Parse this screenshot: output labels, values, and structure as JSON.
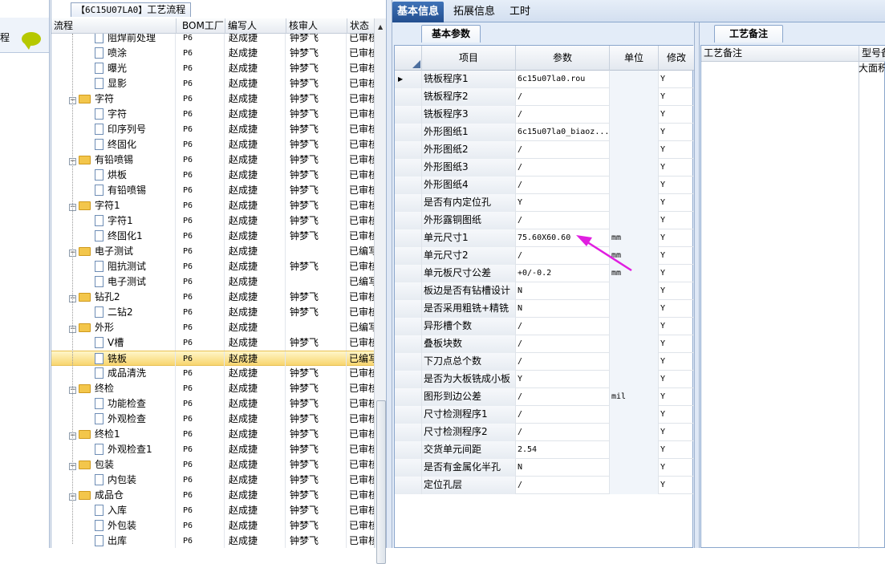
{
  "left_panel": {
    "label": "程"
  },
  "tree": {
    "tab_code": "【6C15U07LA0】",
    "tab_title": "工艺流程",
    "headers": [
      "流程",
      "BOM工厂",
      "编写人",
      "核审人",
      "状态"
    ],
    "rows": [
      {
        "level": 2,
        "type": "doc",
        "name": "阻焊前处理",
        "bom": "P6",
        "writer": "赵成捷",
        "reviewer": "钟梦飞",
        "status": "已审核"
      },
      {
        "level": 2,
        "type": "doc",
        "name": "喷涂",
        "bom": "P6",
        "writer": "赵成捷",
        "reviewer": "钟梦飞",
        "status": "已审核"
      },
      {
        "level": 2,
        "type": "doc",
        "name": "曝光",
        "bom": "P6",
        "writer": "赵成捷",
        "reviewer": "钟梦飞",
        "status": "已审核"
      },
      {
        "level": 2,
        "type": "doc",
        "name": "显影",
        "bom": "P6",
        "writer": "赵成捷",
        "reviewer": "钟梦飞",
        "status": "已审核"
      },
      {
        "level": 1,
        "type": "folder",
        "name": "字符",
        "bom": "P6",
        "writer": "赵成捷",
        "reviewer": "钟梦飞",
        "status": "已审核"
      },
      {
        "level": 2,
        "type": "doc",
        "name": "字符",
        "bom": "P6",
        "writer": "赵成捷",
        "reviewer": "钟梦飞",
        "status": "已审核"
      },
      {
        "level": 2,
        "type": "doc",
        "name": "印序列号",
        "bom": "P6",
        "writer": "赵成捷",
        "reviewer": "钟梦飞",
        "status": "已审核"
      },
      {
        "level": 2,
        "type": "doc",
        "name": "终固化",
        "bom": "P6",
        "writer": "赵成捷",
        "reviewer": "钟梦飞",
        "status": "已审核"
      },
      {
        "level": 1,
        "type": "folder",
        "name": "有铅喷锡",
        "bom": "P6",
        "writer": "赵成捷",
        "reviewer": "钟梦飞",
        "status": "已审核"
      },
      {
        "level": 2,
        "type": "doc",
        "name": "烘板",
        "bom": "P6",
        "writer": "赵成捷",
        "reviewer": "钟梦飞",
        "status": "已审核"
      },
      {
        "level": 2,
        "type": "doc",
        "name": "有铅喷锡",
        "bom": "P6",
        "writer": "赵成捷",
        "reviewer": "钟梦飞",
        "status": "已审核"
      },
      {
        "level": 1,
        "type": "folder",
        "name": "字符1",
        "bom": "P6",
        "writer": "赵成捷",
        "reviewer": "钟梦飞",
        "status": "已审核"
      },
      {
        "level": 2,
        "type": "doc",
        "name": "字符1",
        "bom": "P6",
        "writer": "赵成捷",
        "reviewer": "钟梦飞",
        "status": "已审核"
      },
      {
        "level": 2,
        "type": "doc",
        "name": "终固化1",
        "bom": "P6",
        "writer": "赵成捷",
        "reviewer": "钟梦飞",
        "status": "已审核"
      },
      {
        "level": 1,
        "type": "folder",
        "name": "电子测试",
        "bom": "P6",
        "writer": "赵成捷",
        "reviewer": "",
        "status": "已编写"
      },
      {
        "level": 2,
        "type": "doc",
        "name": "阻抗测试",
        "bom": "P6",
        "writer": "赵成捷",
        "reviewer": "钟梦飞",
        "status": "已审核"
      },
      {
        "level": 2,
        "type": "doc",
        "name": "电子测试",
        "bom": "P6",
        "writer": "赵成捷",
        "reviewer": "",
        "status": "已编写"
      },
      {
        "level": 1,
        "type": "folder",
        "name": "钻孔2",
        "bom": "P6",
        "writer": "赵成捷",
        "reviewer": "钟梦飞",
        "status": "已审核"
      },
      {
        "level": 2,
        "type": "doc",
        "name": "二钻2",
        "bom": "P6",
        "writer": "赵成捷",
        "reviewer": "钟梦飞",
        "status": "已审核"
      },
      {
        "level": 1,
        "type": "folder",
        "name": "外形",
        "bom": "P6",
        "writer": "赵成捷",
        "reviewer": "",
        "status": "已编写"
      },
      {
        "level": 2,
        "type": "doc",
        "name": "V槽",
        "bom": "P6",
        "writer": "赵成捷",
        "reviewer": "钟梦飞",
        "status": "已审核"
      },
      {
        "level": 2,
        "type": "doc",
        "name": "铣板",
        "bom": "P6",
        "writer": "赵成捷",
        "reviewer": "",
        "status": "已编写",
        "selected": true
      },
      {
        "level": 2,
        "type": "doc",
        "name": "成品清洗",
        "bom": "P6",
        "writer": "赵成捷",
        "reviewer": "钟梦飞",
        "status": "已审核"
      },
      {
        "level": 1,
        "type": "folder",
        "name": "终检",
        "bom": "P6",
        "writer": "赵成捷",
        "reviewer": "钟梦飞",
        "status": "已审核"
      },
      {
        "level": 2,
        "type": "doc",
        "name": "功能检查",
        "bom": "P6",
        "writer": "赵成捷",
        "reviewer": "钟梦飞",
        "status": "已审核"
      },
      {
        "level": 2,
        "type": "doc",
        "name": "外观检查",
        "bom": "P6",
        "writer": "赵成捷",
        "reviewer": "钟梦飞",
        "status": "已审核"
      },
      {
        "level": 1,
        "type": "folder",
        "name": "终检1",
        "bom": "P6",
        "writer": "赵成捷",
        "reviewer": "钟梦飞",
        "status": "已审核"
      },
      {
        "level": 2,
        "type": "doc",
        "name": "外观检查1",
        "bom": "P6",
        "writer": "赵成捷",
        "reviewer": "钟梦飞",
        "status": "已审核"
      },
      {
        "level": 1,
        "type": "folder",
        "name": "包装",
        "bom": "P6",
        "writer": "赵成捷",
        "reviewer": "钟梦飞",
        "status": "已审核"
      },
      {
        "level": 2,
        "type": "doc",
        "name": "内包装",
        "bom": "P6",
        "writer": "赵成捷",
        "reviewer": "钟梦飞",
        "status": "已审核"
      },
      {
        "level": 1,
        "type": "folder",
        "name": "成品仓",
        "bom": "P6",
        "writer": "赵成捷",
        "reviewer": "钟梦飞",
        "status": "已审核"
      },
      {
        "level": 2,
        "type": "doc",
        "name": "入库",
        "bom": "P6",
        "writer": "赵成捷",
        "reviewer": "钟梦飞",
        "status": "已审核"
      },
      {
        "level": 2,
        "type": "doc",
        "name": "外包装",
        "bom": "P6",
        "writer": "赵成捷",
        "reviewer": "钟梦飞",
        "status": "已审核"
      },
      {
        "level": 2,
        "type": "doc",
        "name": "出库",
        "bom": "P6",
        "writer": "赵成捷",
        "reviewer": "钟梦飞",
        "status": "已审核"
      }
    ]
  },
  "tabs": [
    "基本信息",
    "拓展信息",
    "工时"
  ],
  "params": {
    "subtab": "基本参数",
    "headers": [
      "项目",
      "参数",
      "单位",
      "修改"
    ],
    "rows": [
      {
        "item": "铣板程序1",
        "param": "6c15u07la0.rou",
        "unit": "",
        "mod": "Y",
        "current": true
      },
      {
        "item": "铣板程序2",
        "param": "/",
        "unit": "",
        "mod": "Y"
      },
      {
        "item": "铣板程序3",
        "param": "/",
        "unit": "",
        "mod": "Y"
      },
      {
        "item": "外形图纸1",
        "param": "6c15u07la0_biaoz...",
        "unit": "",
        "mod": "Y"
      },
      {
        "item": "外形图纸2",
        "param": "/",
        "unit": "",
        "mod": "Y"
      },
      {
        "item": "外形图纸3",
        "param": "/",
        "unit": "",
        "mod": "Y"
      },
      {
        "item": "外形图纸4",
        "param": "/",
        "unit": "",
        "mod": "Y"
      },
      {
        "item": "是否有内定位孔",
        "param": "Y",
        "unit": "",
        "mod": "Y"
      },
      {
        "item": "外形露铜图纸",
        "param": "/",
        "unit": "",
        "mod": "Y"
      },
      {
        "item": "单元尺寸1",
        "param": "75.60X60.60",
        "unit": "mm",
        "mod": "Y"
      },
      {
        "item": "单元尺寸2",
        "param": "/",
        "unit": "mm",
        "mod": "Y"
      },
      {
        "item": "单元板尺寸公差",
        "param": "+0/-0.2",
        "unit": "mm",
        "mod": "Y"
      },
      {
        "item": "板边是否有钻槽设计",
        "param": "N",
        "unit": "",
        "mod": "Y"
      },
      {
        "item": "是否采用粗铣+精铣",
        "param": "N",
        "unit": "",
        "mod": "Y"
      },
      {
        "item": "异形槽个数",
        "param": "/",
        "unit": "",
        "mod": "Y"
      },
      {
        "item": "叠板块数",
        "param": "/",
        "unit": "",
        "mod": "Y"
      },
      {
        "item": "下刀点总个数",
        "param": "/",
        "unit": "",
        "mod": "Y"
      },
      {
        "item": "是否为大板铣成小板",
        "param": "Y",
        "unit": "",
        "mod": "Y"
      },
      {
        "item": "图形到边公差",
        "param": "/",
        "unit": "mil",
        "mod": "Y"
      },
      {
        "item": "尺寸检测程序1",
        "param": "/",
        "unit": "",
        "mod": "Y"
      },
      {
        "item": "尺寸检测程序2",
        "param": "/",
        "unit": "",
        "mod": "Y"
      },
      {
        "item": "交货单元间距",
        "param": "2.54",
        "unit": "",
        "mod": "Y"
      },
      {
        "item": "是否有金属化半孔",
        "param": "N",
        "unit": "",
        "mod": "Y"
      },
      {
        "item": "定位孔层",
        "param": "/",
        "unit": "",
        "mod": "Y"
      }
    ]
  },
  "notes": {
    "tab": "工艺备注",
    "headers": [
      "工艺备注",
      "型号备"
    ],
    "cell": "大面积"
  },
  "colors": {
    "arrow": "#e01ee0",
    "active_tab": "#2b5aa0",
    "selected_row": "#f8d56f"
  }
}
